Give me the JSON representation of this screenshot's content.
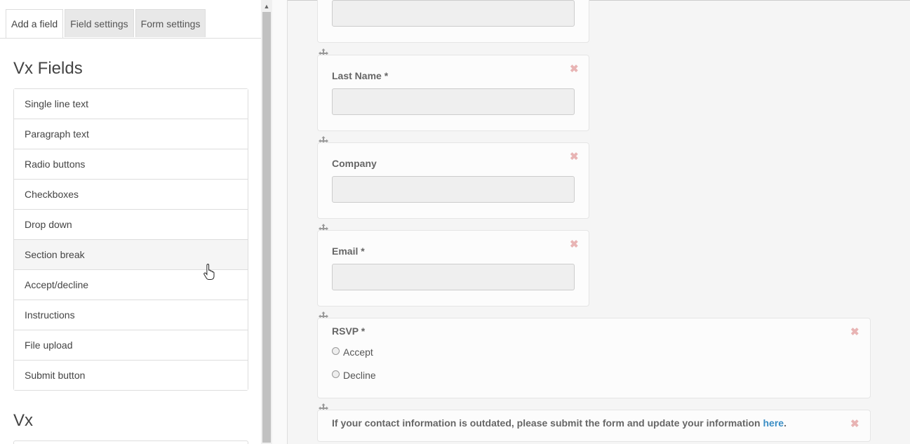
{
  "tabs": [
    "Add a field",
    "Field settings",
    "Form settings"
  ],
  "groups": [
    {
      "title": "Vx Fields"
    },
    {
      "title": "Vx"
    }
  ],
  "fields": [
    "Single line text",
    "Paragraph text",
    "Radio buttons",
    "Checkboxes",
    "Drop down",
    "Section break",
    "Accept/decline",
    "Instructions",
    "File upload",
    "Submit button"
  ],
  "form": {
    "last_name_label": "Last Name *",
    "company_label": "Company",
    "email_label": "Email *",
    "rsvp_label": "RSVP *",
    "rsvp_options": [
      "Accept",
      "Decline"
    ],
    "notice_text": "If your contact information is outdated, please submit the form and update your information ",
    "notice_link": "here",
    "notice_end": "."
  },
  "icons": {
    "remove": "close-icon",
    "move": "move-icon"
  },
  "colors": {
    "link": "#3a8ec5",
    "remove": "#e8b4b4"
  }
}
